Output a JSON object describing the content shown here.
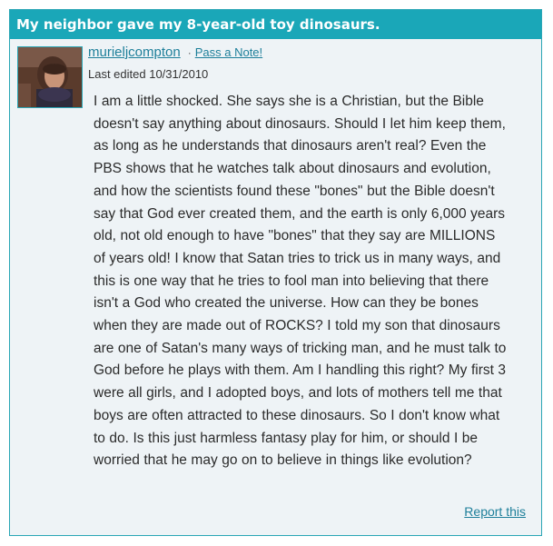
{
  "post": {
    "title": "My neighbor gave my 8-year-old toy dinosaurs.",
    "author": "murieljcompton",
    "separator": "·",
    "pass_note_label": "Pass a Note!",
    "last_edited": "Last edited 10/31/2010",
    "body": "I am a little shocked. She says she is a Christian, but the Bible doesn't say anything about dinosaurs. Should I let him keep them, as long as he understands that dinosaurs aren't real? Even the PBS shows that he watches talk about dinosaurs and evolution, and how the scientists found these \"bones\" but the Bible doesn't say that God ever created them, and the earth is only 6,000 years old, not old enough to have \"bones\" that they say are MILLIONS of years old! I know that Satan tries to trick us in many ways, and this is one way that he tries to fool man into believing that there isn't a God who created the universe. How can they be bones when they are made out of ROCKS? I told my son that dinosaurs are one of Satan's many ways of tricking man, and he must talk to God before he plays with them. Am I handling this right? My first 3 were all girls, and I adopted boys, and lots of mothers tell me that boys are often attracted to these dinosaurs. So I don't know what to do. Is this just harmless fantasy play for him, or should I be worried that he may go on to believe in things like evolution?",
    "report_label": "Report this"
  },
  "colors": {
    "header_bg": "#1aa7b8",
    "card_bg": "#eef3f6",
    "link": "#1e7f9a"
  }
}
